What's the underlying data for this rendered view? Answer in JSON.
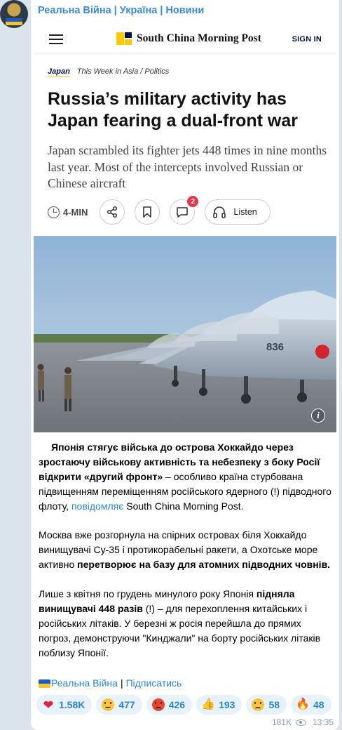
{
  "channel": {
    "name": "Реальна Війна | Україна | Новини"
  },
  "article": {
    "publication": "South China Morning Post",
    "signin_label": "SIGN IN",
    "section": "Japan",
    "topic": "This Week in Asia / Politics",
    "headline": "Russia’s military activity has Japan fearing a dual-front war",
    "dek": "Japan scrambled its fighter jets 448 times in nine months last year. Most of the intercepts involved Russian or Chinese aircraft",
    "read_time": "4-MIN",
    "comment_count": "2",
    "listen_label": "Listen",
    "photo_tail_number": "836"
  },
  "message": {
    "p1": {
      "bold": "Японія стягує війська до острова Хоккайдо через зростаючу військову активність та небезпеку з боку Росії відкрити «другий фронт»",
      "text": " – особливо країна стурбована підвищенням переміщенням російського ядерного (!) підводного флоту, ",
      "link": "повідомляє",
      "tail": " South China Morning Post."
    },
    "p2": {
      "text": "Москва вже розгорнула на спірних островах біля Хоккайдо винищувачі Су-35 і протикорабельні ракети, а Охотське море активно ",
      "bold": "перетворює на базу для атомних підводних човнів."
    },
    "p3": {
      "text1": "Лише з квітня по грудень минулого року Японія ",
      "bold": "підняла винищувачі 448 разів",
      "text2": " (!) – для перехоплення китайських і російських літаків. У березні ж росія перейшла до прямих погроз, демонструючи \"Кинджали\" на борту російських літаків поблизу Японії."
    },
    "signature": {
      "channel_link": "Реальна Війна",
      "separator": "|",
      "subscribe_link": "Підписатись"
    }
  },
  "reactions": [
    {
      "emoji": "heart-icon",
      "count": "1.58K"
    },
    {
      "emoji": "grin-face-icon",
      "count": "477"
    },
    {
      "emoji": "angry-face-icon",
      "count": "426"
    },
    {
      "emoji": "thumbs-up-icon",
      "count": "193"
    },
    {
      "emoji": "sad-face-icon",
      "count": "58"
    },
    {
      "emoji": "fire-icon",
      "count": "48"
    }
  ],
  "meta": {
    "views": "181K",
    "time": "13:35"
  }
}
